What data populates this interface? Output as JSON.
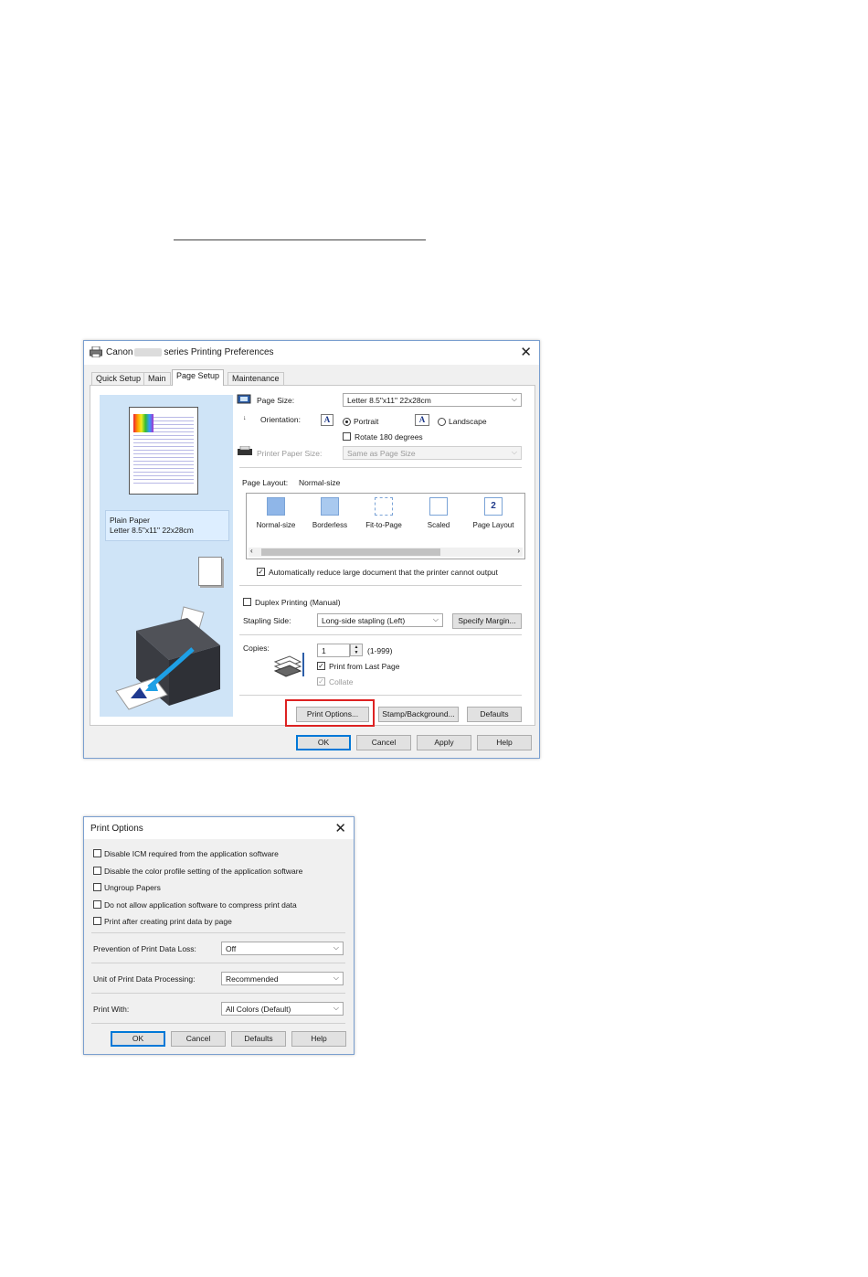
{
  "window1": {
    "title_prefix": "Canon",
    "title_suffix": "series Printing Preferences",
    "close": "✕",
    "tabs": [
      "Quick Setup",
      "Main",
      "Page Setup",
      "Maintenance"
    ],
    "active_tab": "Page Setup",
    "preview": {
      "paper_type": "Plain Paper",
      "paper_size": "Letter 8.5\"x11\" 22x28cm"
    },
    "page_size": {
      "label": "Page Size:",
      "value": "Letter 8.5\"x11\" 22x28cm"
    },
    "orientation": {
      "label": "Orientation:",
      "portrait": "Portrait",
      "landscape": "Landscape",
      "selected": "Portrait",
      "rotate_label": "Rotate 180 degrees",
      "rotate_checked": false
    },
    "printer_paper_size": {
      "label": "Printer Paper Size:",
      "value": "Same as Page Size",
      "disabled": true
    },
    "page_layout": {
      "label": "Page Layout:",
      "current": "Normal-size",
      "items": [
        "Normal-size",
        "Borderless",
        "Fit-to-Page",
        "Scaled",
        "Page Layout"
      ]
    },
    "auto_reduce": {
      "label": "Automatically reduce large document that the printer cannot output",
      "checked": true
    },
    "duplex": {
      "label": "Duplex Printing (Manual)",
      "checked": false
    },
    "stapling": {
      "label": "Stapling Side:",
      "value": "Long-side stapling (Left)",
      "specify_margin": "Specify Margin..."
    },
    "copies": {
      "label": "Copies:",
      "value": "1",
      "range": "(1-999)",
      "print_from_last": "Print from Last Page",
      "print_from_last_checked": true,
      "collate": "Collate",
      "collate_checked": true,
      "collate_disabled": true
    },
    "buttons": {
      "print_options": "Print Options...",
      "stamp_background": "Stamp/Background...",
      "defaults": "Defaults",
      "ok": "OK",
      "cancel": "Cancel",
      "apply": "Apply",
      "help": "Help"
    }
  },
  "window2": {
    "title": "Print Options",
    "close": "✕",
    "options": [
      {
        "label": "Disable ICM required from the application software",
        "checked": false
      },
      {
        "label": "Disable the color profile setting of the application software",
        "checked": false
      },
      {
        "label": "Ungroup Papers",
        "checked": false
      },
      {
        "label": "Do not allow application software to compress print data",
        "checked": false
      },
      {
        "label": "Print after creating print data by page",
        "checked": false
      }
    ],
    "prevention": {
      "label": "Prevention of Print Data Loss:",
      "value": "Off"
    },
    "unit": {
      "label": "Unit of Print Data Processing:",
      "value": "Recommended"
    },
    "print_with": {
      "label": "Print With:",
      "value": "All Colors (Default)"
    },
    "buttons": {
      "ok": "OK",
      "cancel": "Cancel",
      "defaults": "Defaults",
      "help": "Help"
    }
  },
  "colors": {
    "accent_border": "#0078d7",
    "highlight": "#dd2222",
    "preview_bg": "#cfe4f7"
  }
}
